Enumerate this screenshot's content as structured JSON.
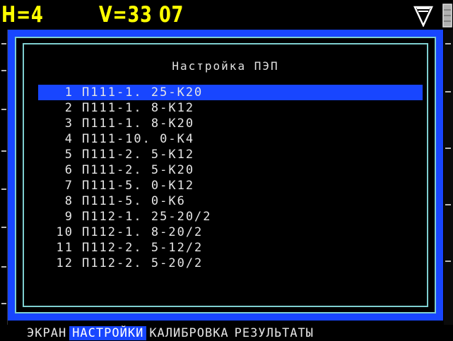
{
  "status": {
    "h_readout": "H=4",
    "v_readout": "V=33 07"
  },
  "icons": {
    "probe": "probe-icon",
    "battery": "battery-icon"
  },
  "dialog": {
    "title": "Настройка ПЭП",
    "items": [
      {
        "num": "1",
        "name": "П111-1. 25-К20",
        "selected": true
      },
      {
        "num": "2",
        "name": "П111-1. 8-К12",
        "selected": false
      },
      {
        "num": "3",
        "name": "П111-1. 8-К20",
        "selected": false
      },
      {
        "num": "4",
        "name": "П111-10. 0-К4",
        "selected": false
      },
      {
        "num": "5",
        "name": "П111-2. 5-К12",
        "selected": false
      },
      {
        "num": "6",
        "name": "П111-2. 5-К20",
        "selected": false
      },
      {
        "num": "7",
        "name": "П111-5. 0-К12",
        "selected": false
      },
      {
        "num": "8",
        "name": "П111-5. 0-К6",
        "selected": false
      },
      {
        "num": "9",
        "name": "П112-1. 25-20/2",
        "selected": false
      },
      {
        "num": "10",
        "name": "П112-1. 8-20/2",
        "selected": false
      },
      {
        "num": "11",
        "name": "П112-2. 5-12/2",
        "selected": false
      },
      {
        "num": "12",
        "name": "П112-2. 5-20/2",
        "selected": false
      }
    ]
  },
  "menu": {
    "screen": "ЭКРАН",
    "settings": "НАСТРОЙКИ",
    "calibration": "КАЛИБРОВКА",
    "results": "РЕЗУЛЬТАТЫ",
    "active": "settings"
  },
  "colors": {
    "status_text": "#ffff00",
    "accent_blue": "#1846ff",
    "frame_cyan": "#7fcfd0",
    "text": "#e6e6e6",
    "background": "#000000"
  }
}
